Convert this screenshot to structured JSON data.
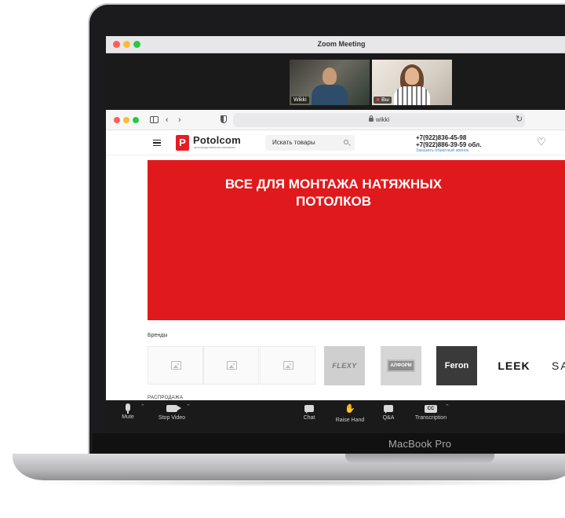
{
  "device": {
    "label": "MacBook Pro"
  },
  "zoom": {
    "title": "Zoom Meeting",
    "participants": [
      {
        "name": "Wikki"
      },
      {
        "name": "Вы",
        "muted": true
      }
    ],
    "controls": {
      "mute": "Mute",
      "stop_video": "Stop Video",
      "chat": "Chat",
      "raise_hand": "Raise Hand",
      "qa": "Q&A",
      "transcription": "Transcription",
      "cc_icon_text": "CC"
    }
  },
  "browser": {
    "url": "wikki"
  },
  "site": {
    "logo_letter": "P",
    "logo_name": "Potolcom",
    "logo_tagline": "производственная компания",
    "search_placeholder": "Искать товары",
    "phone_1": "+7(922)836-45-98",
    "phone_2": "+7(922)886-39-59 обл.",
    "callback_link": "Заказать обратный звонок",
    "hero_title_line1": "ВСЕ ДЛЯ МОНТАЖА НАТЯЖНЫХ",
    "hero_title_line2": "ПОТОЛКОВ",
    "hero_color": "#e0191c",
    "brands_label": "Бренды",
    "brands": [
      "FLEXY",
      "АЛФОРМ",
      "Feron",
      "LEEK",
      "SA"
    ],
    "next_section_label": "РАСПРОДАЖА"
  },
  "colors": {
    "brand_red": "#e31e24",
    "link_blue": "#3b8cd9"
  }
}
